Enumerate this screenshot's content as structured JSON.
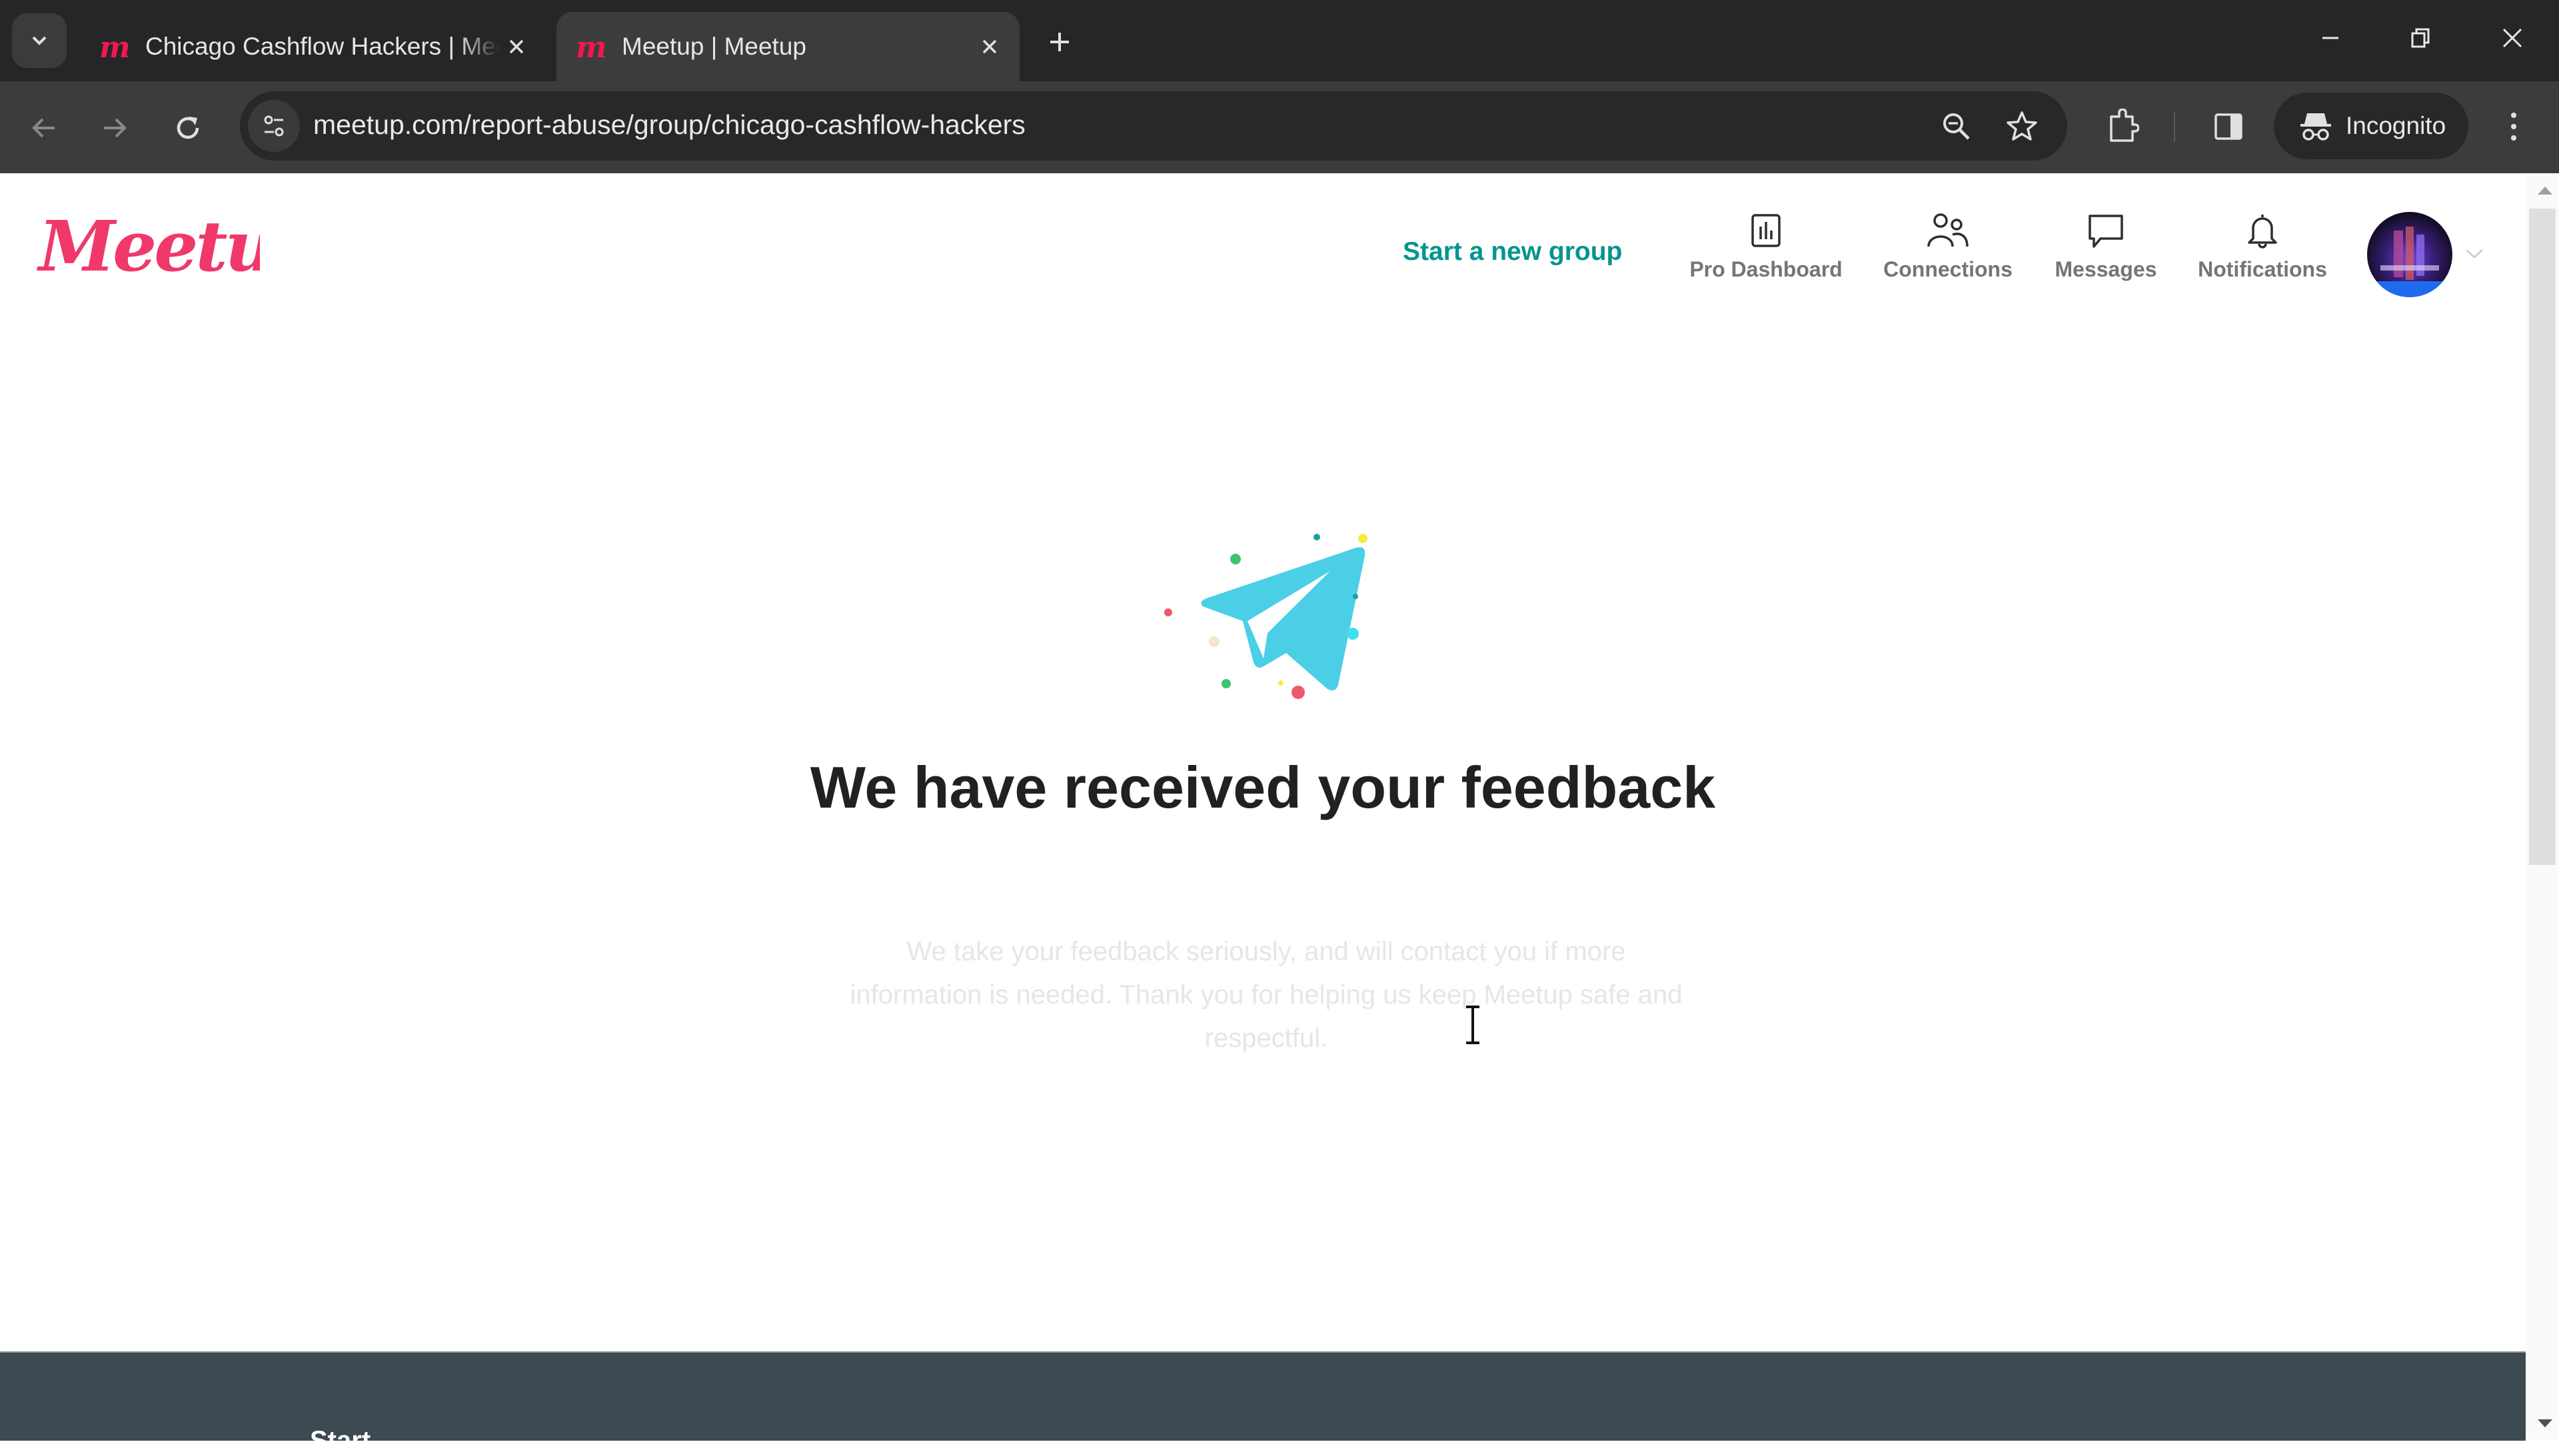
{
  "browser": {
    "tabs": [
      {
        "title": "Chicago Cashflow Hackers | Meetup",
        "active": false
      },
      {
        "title": "Meetup | Meetup",
        "active": true
      }
    ],
    "url": "meetup.com/report-abuse/group/chicago-cashflow-hackers",
    "incognito_label": "Incognito",
    "favicon_color": "#f0194f"
  },
  "header": {
    "logo_text": "Meetup",
    "brand_color": "#f0386b",
    "start_group_label": "Start a new group",
    "accent_color": "#00958e",
    "nav": [
      {
        "label": "Pro Dashboard",
        "icon": "bar-chart-icon"
      },
      {
        "label": "Connections",
        "icon": "people-icon"
      },
      {
        "label": "Messages",
        "icon": "chat-bubble-icon"
      },
      {
        "label": "Notifications",
        "icon": "bell-icon"
      }
    ]
  },
  "main": {
    "illustration": "paper-plane-icon",
    "heading": "We have received your feedback",
    "body": "We take your feedback seriously, and will contact you if more information is needed. Thank you for helping us keep Meetup safe and respectful."
  },
  "footer": {
    "heading_partial": "Start"
  }
}
